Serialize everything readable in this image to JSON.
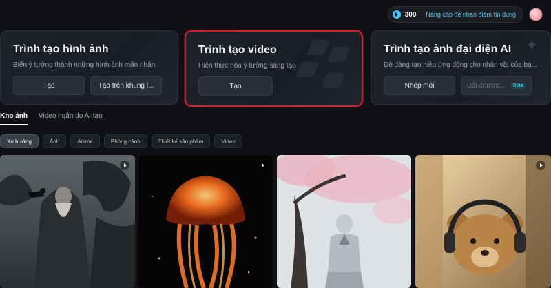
{
  "topbar": {
    "credits": "300",
    "upgrade_text": "Nâng cấp để nhận điểm tín dụng"
  },
  "cards": [
    {
      "title": "Trình tạo hình ảnh",
      "description": "Biến ý tưởng thành những hình ảnh mãn nhãn",
      "buttons": [
        "Tạo",
        "Tạo trên khung l..."
      ]
    },
    {
      "title": "Trình tạo video",
      "description": "Hiện thực hóa ý tưởng sáng tạo",
      "buttons": [
        "Tạo"
      ]
    },
    {
      "title": "Trình tạo ảnh đại diện AI",
      "description": "Dễ dàng tạo hiệu ứng động cho nhân vật của bạ...",
      "buttons": [
        "Nhép môi",
        "Bắt chước..."
      ],
      "badge": "Beta"
    }
  ],
  "tabs": [
    "Kho ảnh",
    "Video ngắn do AI tạo"
  ],
  "filters": [
    "Xu hướng",
    "Ảnh",
    "Anime",
    "Phong cảnh",
    "Thiết kế sản phẩm",
    "Video"
  ],
  "accent": "#57c4e6",
  "highlight_color": "#d81d2c",
  "gallery": [
    {
      "subject": "old wizard with raven and smoky demons",
      "icon": "video-play-icon"
    },
    {
      "subject": "fiery jellyfish in dark sea",
      "icon": "video-play-icon"
    },
    {
      "subject": "robot praying under cherry blossom tree",
      "icon": "video-play-icon"
    },
    {
      "subject": "teddy bear wearing headphones on street",
      "icon": "video-play-icon"
    }
  ]
}
